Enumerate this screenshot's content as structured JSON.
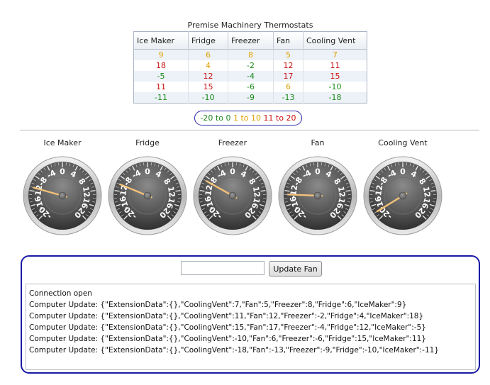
{
  "title": "Premise Machinery Thermostats",
  "table": {
    "headers": [
      "Ice Maker",
      "Fridge",
      "Freezer",
      "Fan",
      "Cooling Vent"
    ],
    "rows": [
      [
        9,
        6,
        8,
        5,
        7
      ],
      [
        18,
        4,
        -2,
        12,
        11
      ],
      [
        -5,
        12,
        -4,
        17,
        15
      ],
      [
        11,
        15,
        -6,
        6,
        -10
      ],
      [
        -11,
        -10,
        -9,
        -13,
        -18
      ]
    ]
  },
  "legend": {
    "green": "-20 to 0",
    "yellow": "1 to 10",
    "red": "11 to 20"
  },
  "colors": {
    "green": "#1a8a1a",
    "yellow": "#e0a100",
    "red": "#cc1111",
    "panel_border": "#1a1aa6",
    "needle": "#f2c078"
  },
  "gauges": [
    {
      "label": "Ice Maker",
      "value": -11
    },
    {
      "label": "Fridge",
      "value": -10
    },
    {
      "label": "Freezer",
      "value": -9
    },
    {
      "label": "Fan",
      "value": -13
    },
    {
      "label": "Cooling Vent",
      "value": -18
    }
  ],
  "gauge_scale": {
    "min": -20,
    "max": 20,
    "ticks": [
      -20,
      -16,
      -12,
      -8,
      -4,
      0,
      4,
      8,
      12,
      16,
      20
    ]
  },
  "controls": {
    "input_value": "",
    "button_label": "Update Fan"
  },
  "log": [
    "Connection open",
    "Computer Update: {\"ExtensionData\":{},\"CoolingVent\":7,\"Fan\":5,\"Freezer\":8,\"Fridge\":6,\"IceMaker\":9}",
    "Computer Update: {\"ExtensionData\":{},\"CoolingVent\":11,\"Fan\":12,\"Freezer\":-2,\"Fridge\":4,\"IceMaker\":18}",
    "Computer Update: {\"ExtensionData\":{},\"CoolingVent\":15,\"Fan\":17,\"Freezer\":-4,\"Fridge\":12,\"IceMaker\":-5}",
    "Computer Update: {\"ExtensionData\":{},\"CoolingVent\":-10,\"Fan\":6,\"Freezer\":-6,\"Fridge\":15,\"IceMaker\":11}",
    "Computer Update: {\"ExtensionData\":{},\"CoolingVent\":-18,\"Fan\":-13,\"Freezer\":-9,\"Fridge\":-10,\"IceMaker\":-11}"
  ]
}
